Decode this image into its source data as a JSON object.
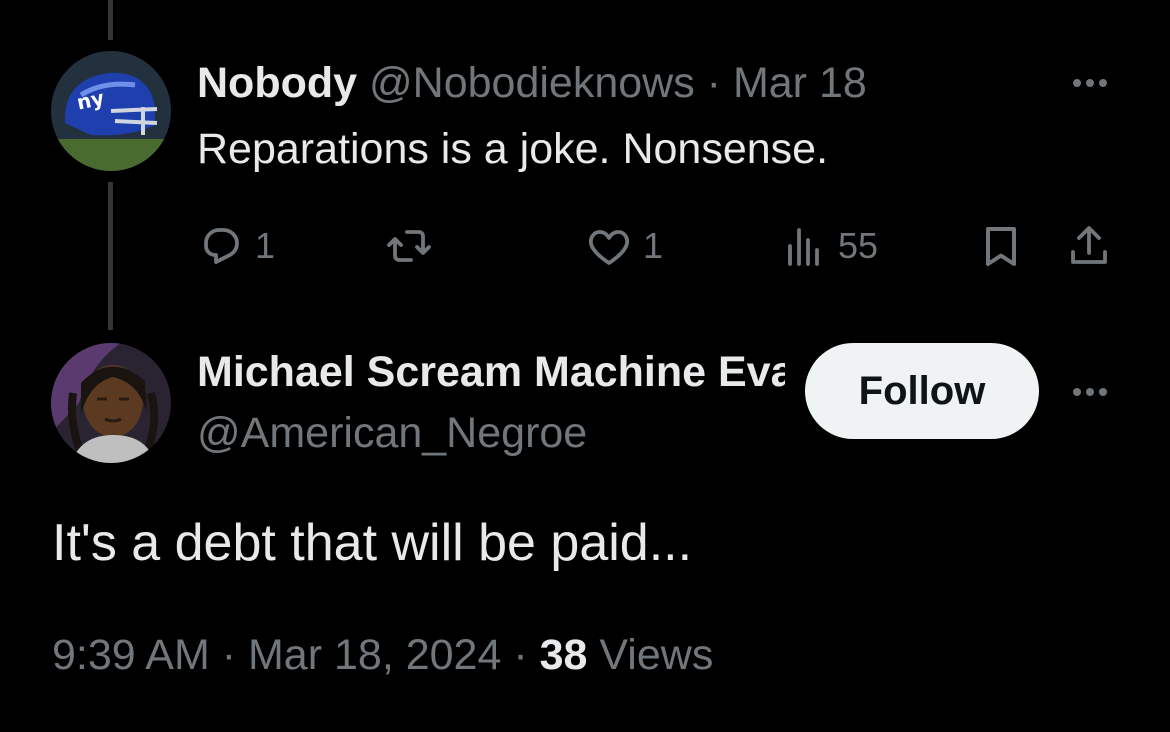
{
  "parent_tweet": {
    "author_name": "Nobody",
    "handle": "@Nobodieknows",
    "separator": " · ",
    "date": "Mar 18",
    "text": "Reparations is a joke. Nonsense.",
    "actions": {
      "reply_count": "1",
      "like_count": "1",
      "view_count": "55"
    }
  },
  "reply_tweet": {
    "author_name": "Michael Scream Machine Evans",
    "handle": "@American_Negroe",
    "follow_label": "Follow",
    "text": "It's a debt that will be paid...",
    "footer": {
      "time": "9:39 AM",
      "separator": " · ",
      "date": "Mar 18, 2024",
      "views_count": "38",
      "views_label": "Views"
    }
  },
  "icons": [
    "giants-helmet-avatar",
    "person-avatar",
    "more-icon",
    "reply-icon",
    "retweet-icon",
    "like-icon",
    "views-icon",
    "bookmark-icon",
    "share-icon"
  ],
  "colors": {
    "background": "#000000",
    "primary_text": "#e7e9ea",
    "secondary_text": "#71767b",
    "thread_line": "#333639",
    "follow_button_bg": "#eff3f4",
    "follow_button_text": "#0f1419"
  }
}
